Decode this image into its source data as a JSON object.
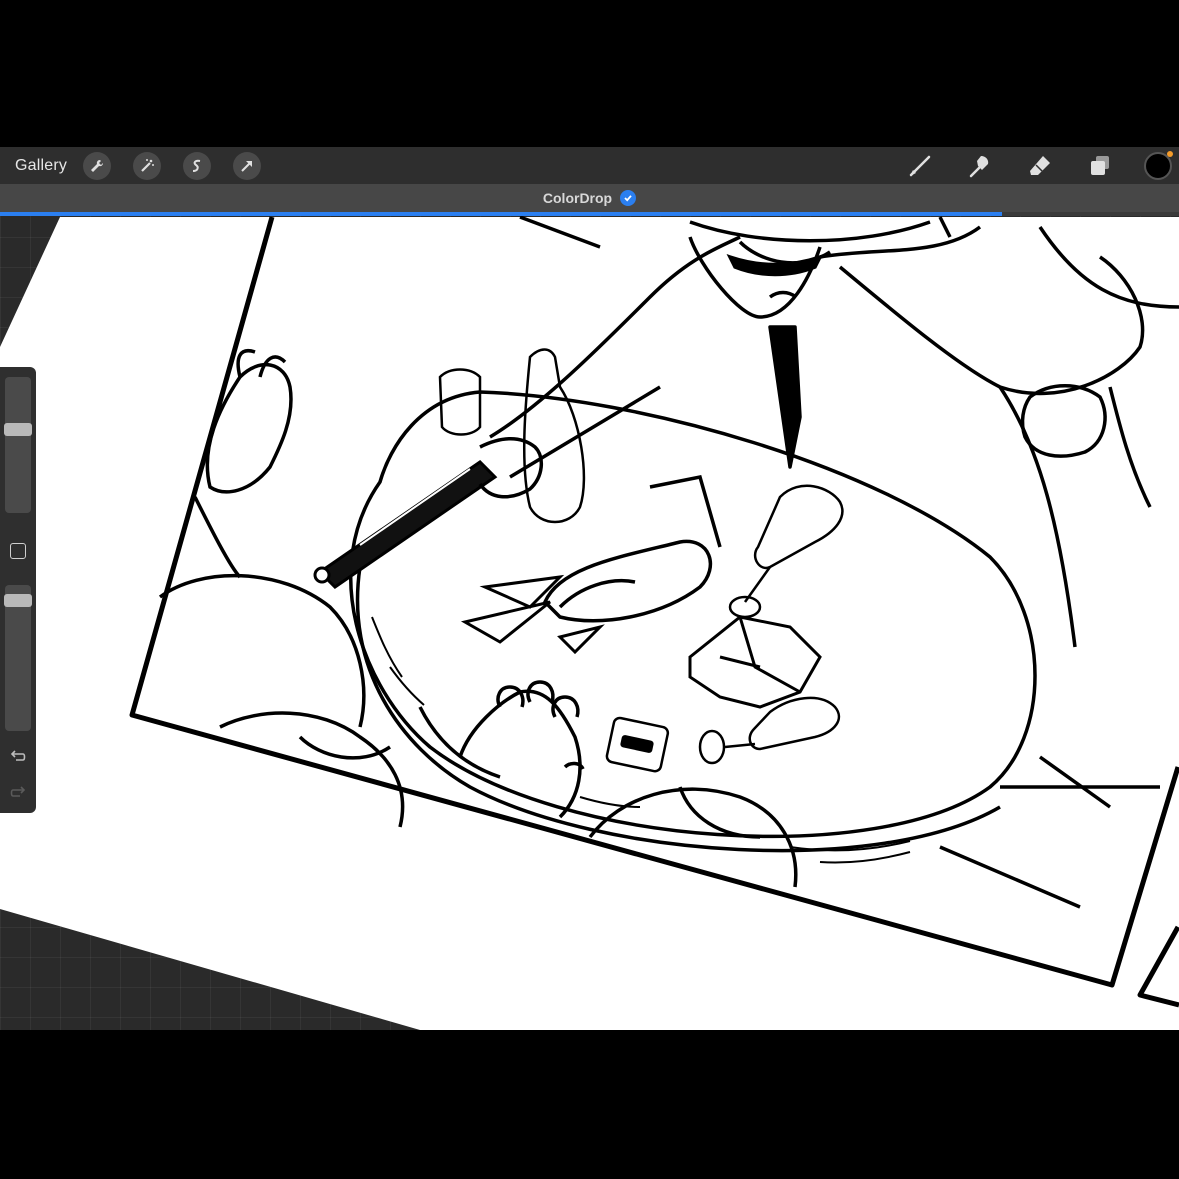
{
  "app": {
    "gallery_label": "Gallery",
    "notice": {
      "text": "ColorDrop",
      "progress": 0.85
    },
    "toolbar_left": [
      {
        "icon": "wrench-icon",
        "label": "Actions"
      },
      {
        "icon": "magic-wand-icon",
        "label": "Adjustments"
      },
      {
        "icon": "selection-icon",
        "label": "Selection"
      },
      {
        "icon": "transform-arrow-icon",
        "label": "Transform"
      }
    ],
    "toolbar_right": [
      {
        "icon": "brush-icon",
        "label": "Paint"
      },
      {
        "icon": "smudge-icon",
        "label": "Smudge"
      },
      {
        "icon": "eraser-icon",
        "label": "Erase"
      },
      {
        "icon": "layers-icon",
        "label": "Layers"
      }
    ],
    "current_color": "#000000",
    "accent_color": "#2b7ff0",
    "sidebar": {
      "brush_size": 0.63,
      "brush_opacity": 0.93
    }
  }
}
